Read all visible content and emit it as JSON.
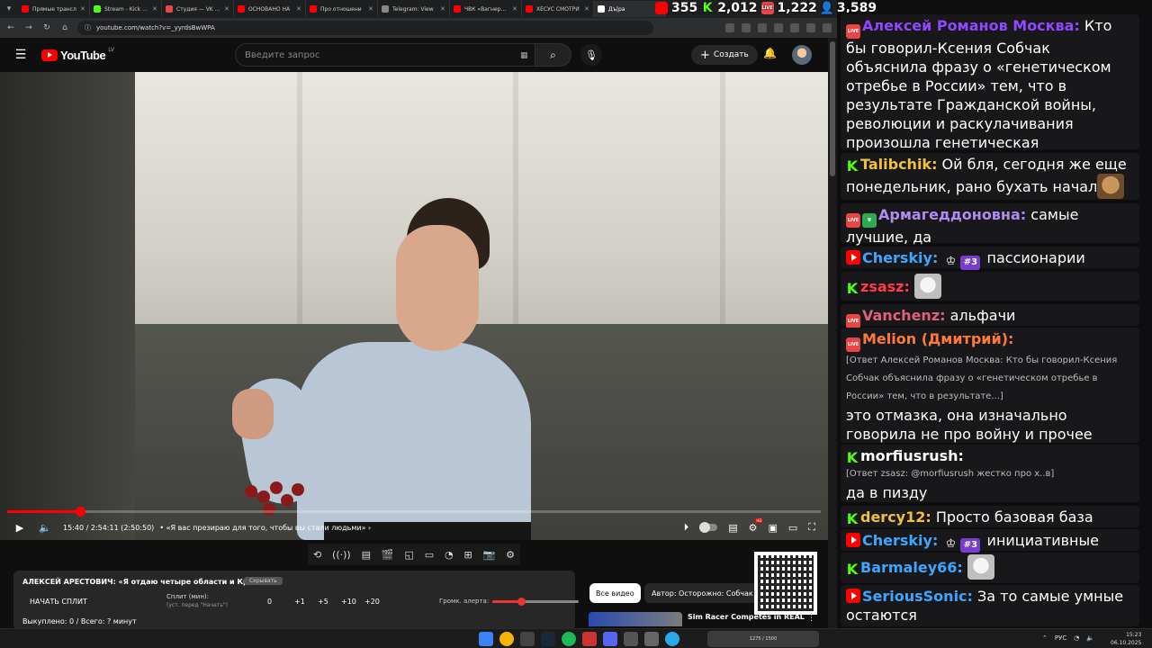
{
  "browser": {
    "tabs": [
      {
        "title": "Прямые трансл",
        "color": "#ff0000"
      },
      {
        "title": "Stream - Kick Da",
        "color": "#53fc18"
      },
      {
        "title": "Студия — VK Be",
        "color": "#e64646"
      },
      {
        "title": "ОСНОВАНО НА",
        "color": "#ff0000"
      },
      {
        "title": "Про отношени",
        "color": "#ff0000"
      },
      {
        "title": "Telegram: View",
        "color": "#888888"
      },
      {
        "title": "ЧВК «Вагнер» М",
        "color": "#ff0000"
      },
      {
        "title": "ХЕСУС СМОТРИ",
        "color": "#ff0000"
      },
      {
        "title": "Дъ|ра",
        "color": "#ffffff"
      }
    ],
    "url": "youtube.com/watch?v=_yyrdsBwWPA"
  },
  "stream_stats": {
    "youtube_viewers": "355",
    "kick_viewers": "2,012",
    "vk_viewers": "1,222",
    "total_viewers": "3,589"
  },
  "youtube": {
    "logo_text": "YouTube",
    "country": "LV",
    "search_placeholder": "Введите запрос",
    "create_label": "Создать"
  },
  "player": {
    "time": "15:40 / 2:54:11 (2:50:50)",
    "chapter": "«Я вас презираю для того, чтобы вы стали людьми»",
    "progress": 0.09
  },
  "split_panel": {
    "title": "АЛЕКСЕЙ АРЕСТОВИЧ: «Я отдаю четыре области и Крым»",
    "hide_label": "Скрывать",
    "start_label": "НАЧАТЬ СПЛИТ",
    "split_label": "Сплит (мин):",
    "split_sub": "(уст. перед \"Начать\")",
    "split_value": "0",
    "increments": [
      "+1",
      "+5",
      "+10",
      "+20"
    ],
    "volume_label": "Громк. алерта:",
    "volume": 0.33,
    "status": "Выкуплено: 0 / Всего: ? минут"
  },
  "sidebar": {
    "chip_all": "Все видео",
    "chip_author": "Автор: Осторожно: Собчак",
    "rec_title": "Sim Racer Competes in REAL"
  },
  "chat": {
    "messages": [
      {
        "platform": "vk",
        "nick": "Алексей Романов Москва:",
        "nick_color": "#9147ff",
        "text": " Кто бы говорил-Ксения Собчак объяснила фразу о «генетическом отребье в России» тем, что в результате Гражданской войны, революции и раскулачивания произошла генетическая катастрофа."
      },
      {
        "platform": "kick",
        "nick": "Talibchik:",
        "nick_color": "#f0c040",
        "text": " Ой бля, сегодня же еще понедельник, рано бухать начал"
      },
      {
        "platform": "vk",
        "nick": "Армагеддоновна:",
        "nick_color": "#b18cf0",
        "text": " самые лучшие, да"
      },
      {
        "platform": "yt",
        "nick": "Cherskiy:",
        "nick_color": "#3ea6ff",
        "rank": "#3",
        "text": " пассионарии"
      },
      {
        "platform": "kick",
        "nick": "zsasz:",
        "nick_color": "#ff3a4a",
        "text": ""
      },
      {
        "platform": "vk",
        "nick": "Vanchenz:",
        "nick_color": "#e0607e",
        "text": " альфачи"
      },
      {
        "platform": "vk",
        "nick": "Melion (Дмитрий):",
        "nick_color": "#ff7a3a",
        "reply": "[Ответ Алексей Романов Москва: Кто бы говорил-Ксения Собчак объяснила фразу о «генетическом отребье в России» тем, что в результате...]",
        "text": "это отмазка, она изначально говорила не про войну и прочее"
      },
      {
        "platform": "kick",
        "nick": "morfiusrush:",
        "nick_color": "#ffffff",
        "reply": "[Ответ zsasz: @morfiusrush жестко про х..в]",
        "text": "да в пизду"
      },
      {
        "platform": "kick",
        "nick": "dercy12:",
        "nick_color": "#f0c040",
        "text": " Просто базовая база"
      },
      {
        "platform": "yt",
        "nick": "Cherskiy:",
        "nick_color": "#3ea6ff",
        "rank": "#3",
        "text": " инициативные"
      },
      {
        "platform": "kick",
        "nick": "Barmaley66:",
        "nick_color": "#3ea6ff",
        "text": ""
      },
      {
        "platform": "yt",
        "nick": "SeriousSonic:",
        "nick_color": "#3ea6ff",
        "text": " За то самые умные остаются"
      }
    ]
  },
  "taskbar": {
    "widget_text": "1275 / 1500",
    "lang": "РУС",
    "time": "15:23",
    "date": "06.10.2025"
  }
}
